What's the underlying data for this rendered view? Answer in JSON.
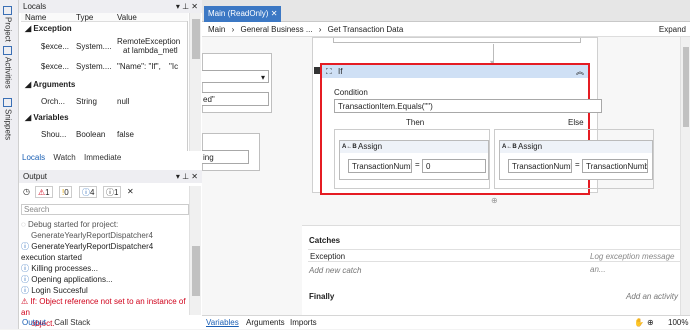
{
  "siderail": {
    "items": [
      "Project",
      "Activities",
      "Snippets"
    ]
  },
  "locals": {
    "title": "Locals",
    "columns": [
      "Name",
      "Type",
      "Value"
    ],
    "groups": [
      {
        "label": "Exception",
        "rows": [
          {
            "name": "$exce...",
            "type": "System....",
            "value1": "RemoteException",
            "value2": "at lambda_metl"
          },
          {
            "name": "$exce...",
            "type": "System....",
            "value1": "\"Name\": \"If\",",
            "value2": "\"Ic"
          }
        ]
      },
      {
        "label": "Arguments",
        "rows": [
          {
            "name": "Orch...",
            "type": "String",
            "value1": "null"
          }
        ]
      },
      {
        "label": "Variables",
        "rows": [
          {
            "name": "Shou...",
            "type": "Boolean",
            "value1": "false"
          }
        ]
      }
    ],
    "tabs": [
      "Locals",
      "Watch",
      "Immediate"
    ]
  },
  "output": {
    "title": "Output",
    "counts": {
      "errors": "1",
      "warnings": "0",
      "info": "4",
      "trace": "1"
    },
    "search_placeholder": "Search",
    "lines": [
      {
        "text": "Debug started for project:",
        "type": "debug"
      },
      {
        "text": "GenerateYearlyReportDispatcher4",
        "type": "debug-cont"
      },
      {
        "text": "GenerateYearlyReportDispatcher4 execution started",
        "type": "info"
      },
      {
        "text": "Killing processes...",
        "type": "info"
      },
      {
        "text": "Opening applications...",
        "type": "info"
      },
      {
        "text": "Login Succesful",
        "type": "info"
      },
      {
        "text": "If: Object reference not set to an instance of an",
        "type": "error"
      },
      {
        "text": "object.",
        "type": "error-cont"
      }
    ],
    "tabs": [
      "Output",
      "Call Stack"
    ]
  },
  "editor": {
    "tab_label": "Main (ReadOnly)",
    "breadcrumbs": [
      "Main",
      "General Business ...",
      "Get Transaction Data"
    ],
    "expand_label": "Expand",
    "partial_field": "ed\"",
    "partial_string": "ing",
    "if_activity": {
      "title": "If",
      "condition_label": "Condition",
      "condition_value": "TransactionItem.Equals(\"\")",
      "then_label": "Then",
      "else_label": "Else",
      "then_assign": {
        "title": "Assign",
        "to": "TransactionNumbe",
        "value": "0"
      },
      "else_assign": {
        "title": "Assign",
        "to": "TransactionNumbe",
        "value": "TransactionNumbe"
      }
    },
    "catches": {
      "title": "Catches",
      "exception_label": "Exception",
      "exception_placeholder": "Log exception message an...",
      "add_new": "Add new catch"
    },
    "finally": {
      "title": "Finally",
      "add_activity": "Add an activity"
    }
  },
  "statusbar": {
    "tabs": [
      "Variables",
      "Arguments",
      "Imports"
    ],
    "zoom": "100%"
  },
  "colors": {
    "accent": "#3c78c4",
    "error": "#d0021b",
    "selection": "#e51c23"
  }
}
